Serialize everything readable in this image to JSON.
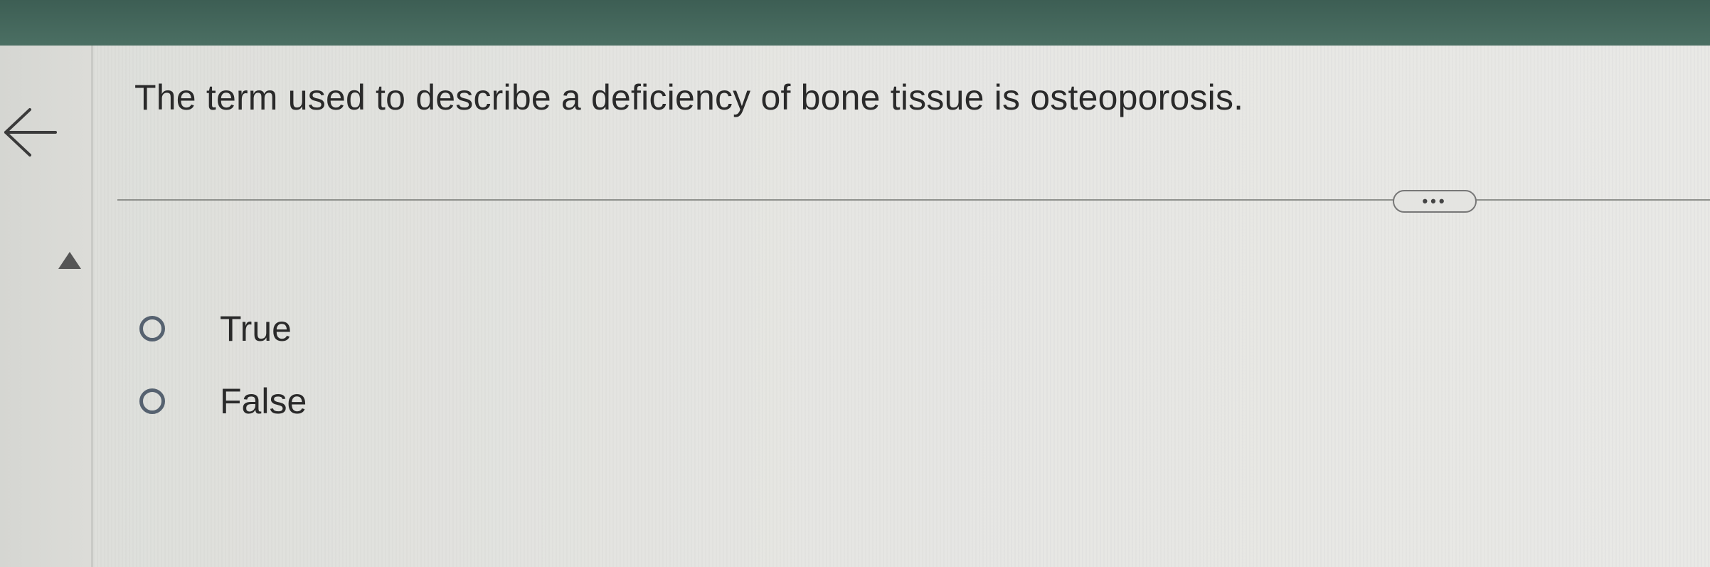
{
  "question": {
    "text": "The term used to describe a deficiency of bone tissue is osteoporosis."
  },
  "toolbar": {
    "back_icon": "arrow-left-icon",
    "collapse_icon": "triangle-up-icon",
    "more_label": "•••"
  },
  "options": [
    {
      "label": "True",
      "selected": false
    },
    {
      "label": "False",
      "selected": false
    }
  ],
  "colors": {
    "header_bar": "#4b6f63",
    "radio_border": "#566270",
    "text": "#2a2a2a"
  }
}
